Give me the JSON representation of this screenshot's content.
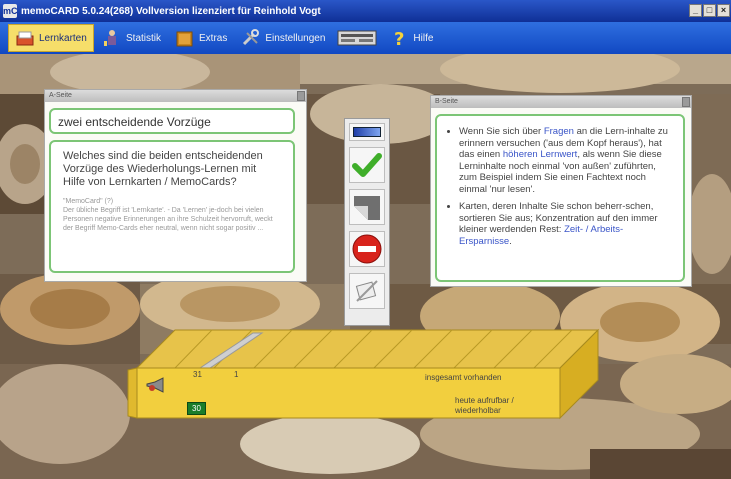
{
  "window": {
    "icon_text": "mC",
    "title": "memoCARD 5.0.24(268)  Vollversion lizenziert für Reinhold Vogt",
    "controls": [
      "_",
      "□",
      "×"
    ]
  },
  "menu": [
    {
      "label": "Lernkarten",
      "icon": "index-box-icon",
      "active": true
    },
    {
      "label": "Statistik",
      "icon": "stats-figure-icon",
      "active": false
    },
    {
      "label": "Extras",
      "icon": "folder-icon",
      "active": false
    },
    {
      "label": "Einstellungen",
      "icon": "tools-icon",
      "active": false
    },
    {
      "label": "",
      "icon": "keyboard-icon",
      "active": false
    },
    {
      "label": "Hilfe",
      "icon": "help-icon",
      "active": false
    }
  ],
  "front_card": {
    "header": "A-Seite",
    "title": "zwei entscheidende Vorzüge",
    "question": "Welches sind die beiden entscheidenden Vorzüge des Wiederholungs-Lernen mit Hilfe von Lernkarten / MemoCards?",
    "note_label": "\"MemoCard\" (?)",
    "note_text": "Der übliche Begriff ist 'Lernkarte'. - Da 'Lernen' je-doch bei vielen Personen negative Erinnerungen an ihre Schulzeit hervorruft, weckt der Begriff Memo-Cards eher neutral, wenn nicht sogar positiv ..."
  },
  "back_card": {
    "header": "B-Seite",
    "bullets": [
      {
        "parts": [
          {
            "t": "Wenn Sie sich über ",
            "hl": false
          },
          {
            "t": "Fragen",
            "hl": true
          },
          {
            "t": " an die Lern-inhalte zu erinnern versuchen ('aus dem Kopf heraus'), hat das einen ",
            "hl": false
          },
          {
            "t": "höheren Lernwert",
            "hl": true
          },
          {
            "t": ", als wenn Sie diese Lerninhalte noch einmal 'von außen' zuführten, zum Beispiel indem Sie einen Fachtext noch einmal 'nur lesen'.",
            "hl": false
          }
        ]
      },
      {
        "parts": [
          {
            "t": "Karten, deren Inhalte Sie schon beherr-schen, sortieren Sie aus; Konzentration auf den immer kleiner werdenden Rest: ",
            "hl": false
          },
          {
            "t": "Zeit- / Arbeits-Ersparnisse",
            "hl": true
          },
          {
            "t": ".",
            "hl": false
          }
        ]
      }
    ]
  },
  "tools": [
    {
      "name": "progress-tool",
      "icon": "progress-bar-icon"
    },
    {
      "name": "correct-button",
      "icon": "checkmark-icon"
    },
    {
      "name": "flip-card-button",
      "icon": "card-corner-icon"
    },
    {
      "name": "wrong-button",
      "icon": "no-entry-icon"
    },
    {
      "name": "remove-card-button",
      "icon": "edit-card-icon"
    }
  ],
  "box": {
    "count_top_1": "31",
    "count_top_2": "1",
    "total_label": "insgesamt vorhanden",
    "today_label_1": "heute aufrufbar /",
    "today_label_2": "wiederholbar",
    "today_count": "30",
    "color": "#f2cf3e"
  },
  "colors": {
    "accent_green": "#7cc576",
    "menu_blue": "#1f5bd6",
    "highlight_text": "#3a55c8"
  }
}
